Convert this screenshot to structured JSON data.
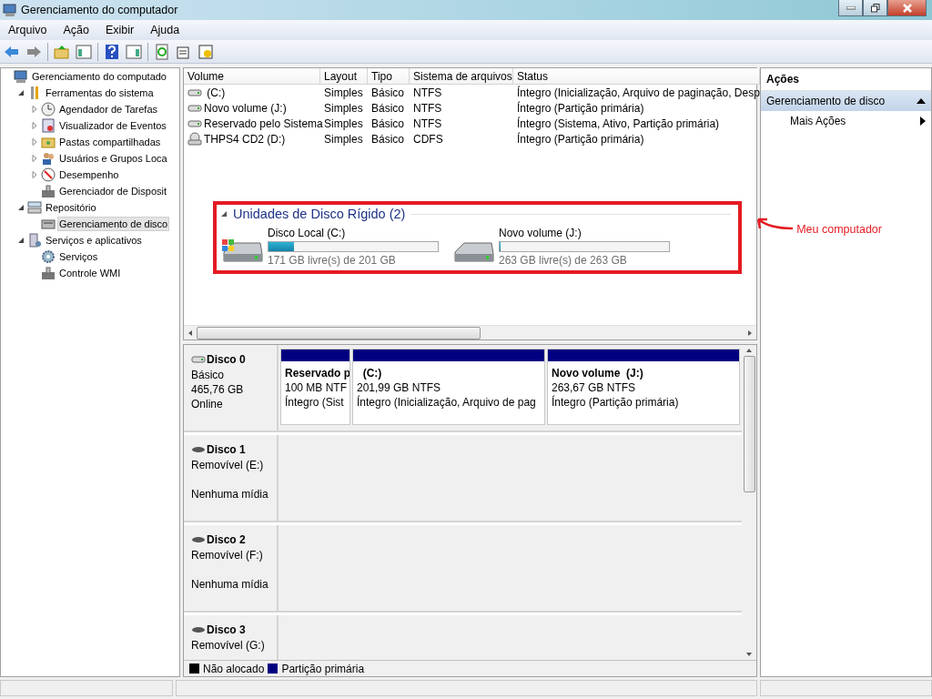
{
  "window": {
    "title": "Gerenciamento do computador"
  },
  "menu": [
    "Arquivo",
    "Ação",
    "Exibir",
    "Ajuda"
  ],
  "tree": [
    {
      "label": "Gerenciamento do computado",
      "selected": false,
      "children": [
        {
          "label": "Ferramentas do sistema",
          "expanded": true,
          "selected": false,
          "children": [
            {
              "label": "Agendador de Tarefas",
              "expanded": false,
              "selected": false
            },
            {
              "label": "Visualizador de Eventos",
              "expanded": false,
              "selected": false
            },
            {
              "label": "Pastas compartilhadas",
              "expanded": false,
              "selected": false
            },
            {
              "label": "Usuários e Grupos Loca",
              "expanded": false,
              "selected": false
            },
            {
              "label": "Desempenho",
              "expanded": false,
              "selected": false
            },
            {
              "label": "Gerenciador de Disposit",
              "selected": false
            }
          ]
        },
        {
          "label": "Repositório",
          "expanded": true,
          "selected": false,
          "children": [
            {
              "label": "Gerenciamento de disco",
              "selected": true
            }
          ]
        },
        {
          "label": "Serviços e aplicativos",
          "expanded": true,
          "selected": false,
          "children": [
            {
              "label": "Serviços",
              "selected": false
            },
            {
              "label": "Controle WMI",
              "selected": false
            }
          ]
        }
      ]
    }
  ],
  "volumes": {
    "columns": [
      "Volume",
      "Layout",
      "Tipo",
      "Sistema de arquivos",
      "Status"
    ],
    "rows": [
      {
        "kind": "hdd",
        "cells": [
          " (C:)",
          "Simples",
          "Básico",
          "NTFS",
          "Íntegro (Inicialização, Arquivo de paginação, Desp"
        ]
      },
      {
        "kind": "hdd",
        "cells": [
          "Novo volume (J:)",
          "Simples",
          "Básico",
          "NTFS",
          "Íntegro (Partição primária)"
        ]
      },
      {
        "kind": "hdd",
        "cells": [
          "Reservado pelo Sistema",
          "Simples",
          "Básico",
          "NTFS",
          "Íntegro (Sistema, Ativo, Partição primária)"
        ]
      },
      {
        "kind": "cd",
        "cells": [
          "THPS4 CD2 (D:)",
          "Simples",
          "Básico",
          "CDFS",
          "Íntegro (Partição primária)"
        ]
      }
    ]
  },
  "drive_group": {
    "title": "Unidades de Disco Rígido (2)",
    "drives": [
      {
        "name": "Disco Local (C:)",
        "kind": "system",
        "level": 0.15,
        "free": "171 GB livre(s) de 201 GB"
      },
      {
        "name": "Novo volume (J:)",
        "kind": "data",
        "level": 0,
        "free": "263 GB livre(s) de 263 GB"
      }
    ]
  },
  "annotation": {
    "label": "Meu computador"
  },
  "disks": [
    {
      "name": "Disco 0",
      "kind": "basic",
      "lines": [
        "Básico",
        "465,76 GB",
        "Online"
      ],
      "partitions": [
        {
          "title": "Reservado p",
          "size": "100 MB NTF",
          "status": "Íntegro (Sist"
        },
        {
          "title": "  (C:)",
          "size": "201,99 GB NTFS",
          "status": "Íntegro (Inicialização, Arquivo de pag"
        },
        {
          "title": "Novo volume  (J:)",
          "size": "263,67 GB NTFS",
          "status": "Íntegro (Partição primária)"
        }
      ]
    },
    {
      "name": "Disco 1",
      "kind": "removable",
      "lines": [
        "Removível (E:)",
        "Nenhuma mídia"
      ]
    },
    {
      "name": "Disco 2",
      "kind": "removable",
      "lines": [
        "Removível (F:)",
        "Nenhuma mídia"
      ]
    },
    {
      "name": "Disco 3",
      "kind": "removable",
      "lines": [
        "Removível (G:)"
      ]
    }
  ],
  "legend": [
    {
      "label": "Não alocado",
      "color": "#000000"
    },
    {
      "label": "Partição primária",
      "color": "#000080"
    }
  ],
  "actions": {
    "title": "Ações",
    "section": "Gerenciamento de disco",
    "items": [
      "Mais Ações"
    ]
  }
}
